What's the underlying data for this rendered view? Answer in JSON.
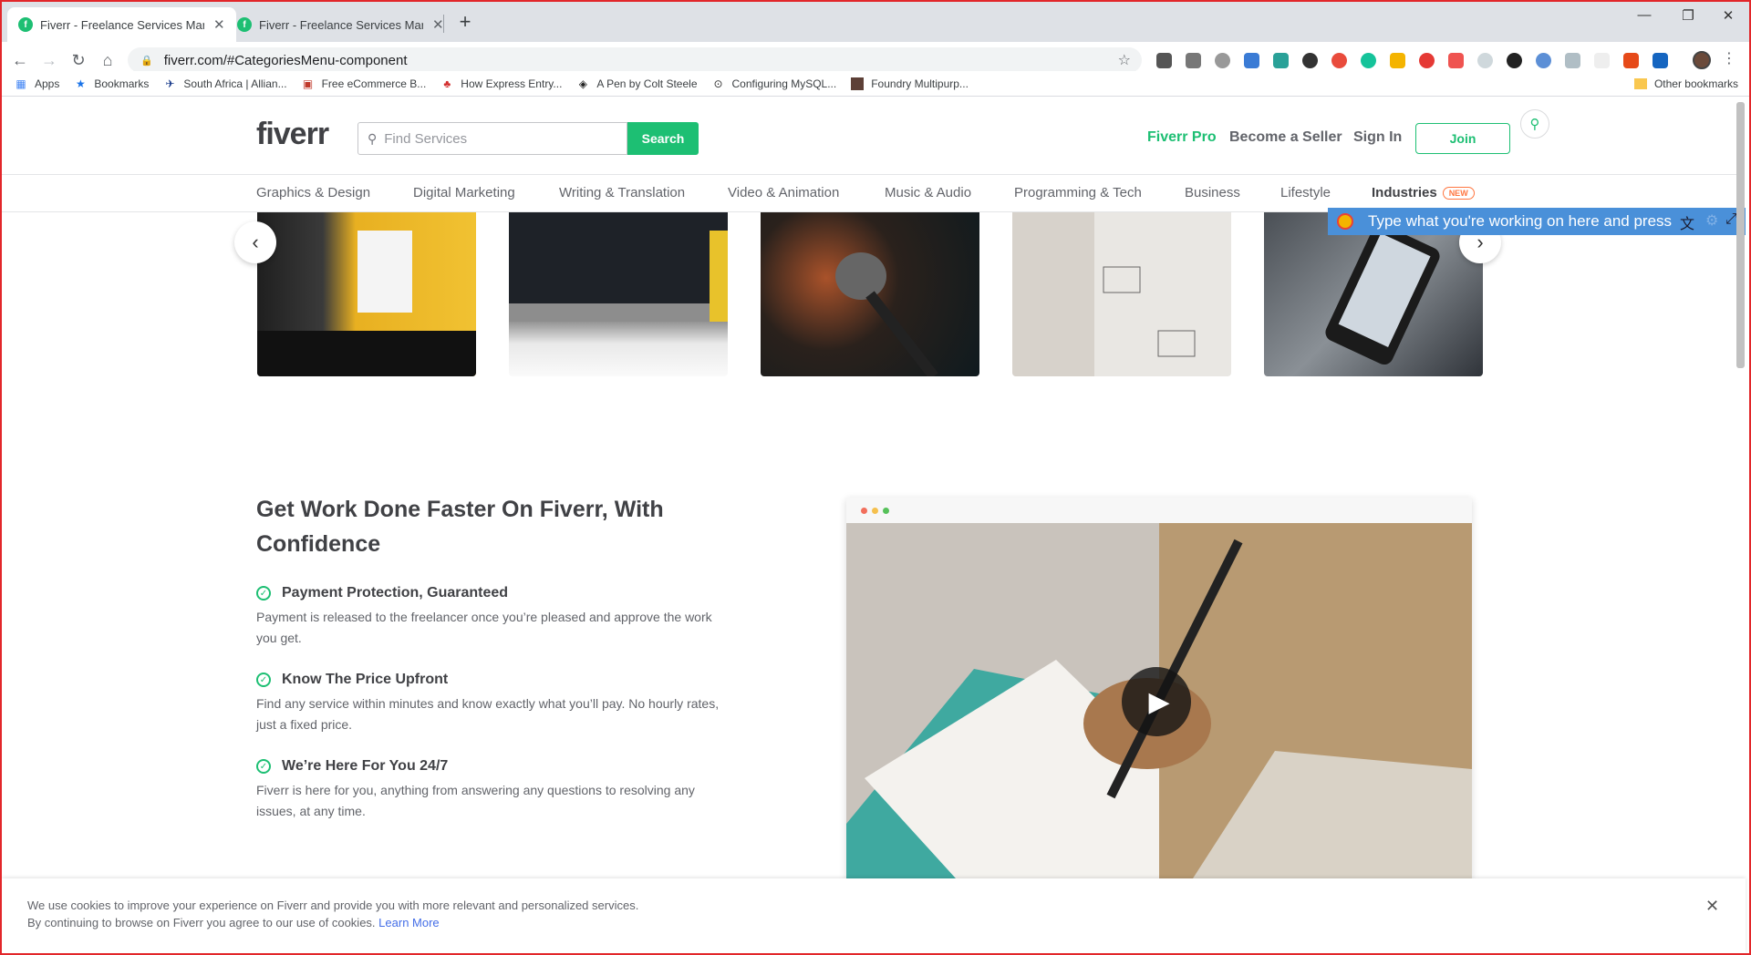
{
  "browser": {
    "tabs": [
      {
        "title": "Fiverr - Freelance Services Marke",
        "active": true
      },
      {
        "title": "Fiverr - Freelance Services Marke",
        "active": false
      }
    ],
    "url": "fiverr.com/#CategoriesMenu-component",
    "bookmarks": [
      {
        "label": "Apps",
        "icon": "apps-grid-icon"
      },
      {
        "label": "Bookmarks",
        "icon": "star-icon"
      },
      {
        "label": "South Africa | Allian...",
        "icon": "airline-icon"
      },
      {
        "label": "Free eCommerce B...",
        "icon": "page-icon"
      },
      {
        "label": "How Express Entry...",
        "icon": "maple-leaf-icon"
      },
      {
        "label": "A Pen by Colt Steele",
        "icon": "codepen-icon"
      },
      {
        "label": "Configuring MySQL...",
        "icon": "play-circle-icon"
      },
      {
        "label": "Foundry Multipurp...",
        "icon": "theme-icon"
      }
    ],
    "other_bookmarks": "Other bookmarks"
  },
  "header": {
    "logo": "fiverr",
    "search_placeholder": "Find Services",
    "search_button": "Search",
    "fiverr_pro": "Fiverr Pro",
    "become_seller": "Become a Seller",
    "sign_in": "Sign In",
    "join": "Join"
  },
  "categories": [
    "Graphics & Design",
    "Digital Marketing",
    "Writing & Translation",
    "Video & Animation",
    "Music & Audio",
    "Programming & Tech",
    "Business",
    "Lifestyle",
    "Industries"
  ],
  "industries_badge": "NEW",
  "assistant_bar": {
    "text": "Type what you're working on here and press"
  },
  "section": {
    "headline": "Get Work Done Faster On Fiverr, With Confidence",
    "features": [
      {
        "title": "Payment Protection, Guaranteed",
        "text": "Payment is released to the freelancer once you’re pleased and approve the work you get."
      },
      {
        "title": "Know The Price Upfront",
        "text": "Find any service within minutes and know exactly what you’ll pay. No hourly rates, just a fixed price."
      },
      {
        "title": "We’re Here For You 24/7",
        "text": "Fiverr is here for you, anything from answering any questions to resolving any issues, at any time."
      }
    ]
  },
  "cookie": {
    "line1": "We use cookies to improve your experience on Fiverr and provide you with more relevant and personalized services.",
    "line2": "By continuing to browse on Fiverr you agree to our use of cookies.",
    "learn_more": "Learn More"
  },
  "colors": {
    "brand_green": "#1dbf73",
    "heading": "#404145",
    "body_text": "#62646a",
    "badge_orange": "#ff7640",
    "assistant_blue": "#4a90d9"
  }
}
